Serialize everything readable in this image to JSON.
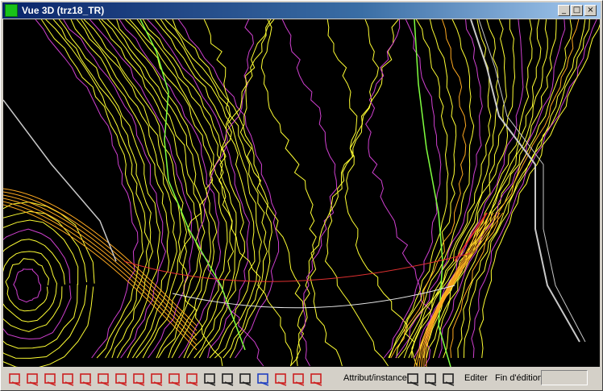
{
  "window": {
    "title": "Vue 3D (trz18_TR)"
  },
  "title_buttons": [
    "_",
    "□",
    "×"
  ],
  "colors": {
    "background": "#000000",
    "contour_yellow": "#ffff33",
    "contour_magenta": "#d040d0",
    "contour_green": "#80ff40",
    "contour_orange": "#ffaa20",
    "road_gray": "#c8c8c8",
    "section_red": "#e03030",
    "section_white": "#e8e8e8"
  },
  "toolbar": {
    "icons": [
      "zoom-window-icon",
      "zoom-in-icon",
      "zoom-out-icon",
      "zoom-previous-icon",
      "zoom-extents-icon",
      "zoom-all-icon",
      "layers-icon",
      "view-plan-icon",
      "view-frame-icon",
      "rotate-icon",
      "pencil-icon",
      "line-icon",
      "polyline-icon",
      "arc-icon",
      "undo-icon",
      "triangulate-icon",
      "triangulate-edit-icon",
      "break-line-icon"
    ],
    "attribute_label": "Attribut/instance",
    "tools2": [
      "walker-icon",
      "cross-tool-icon",
      "profile-icon"
    ],
    "edit_label": "Editer",
    "end_edit_label": "Fin d'édition"
  }
}
